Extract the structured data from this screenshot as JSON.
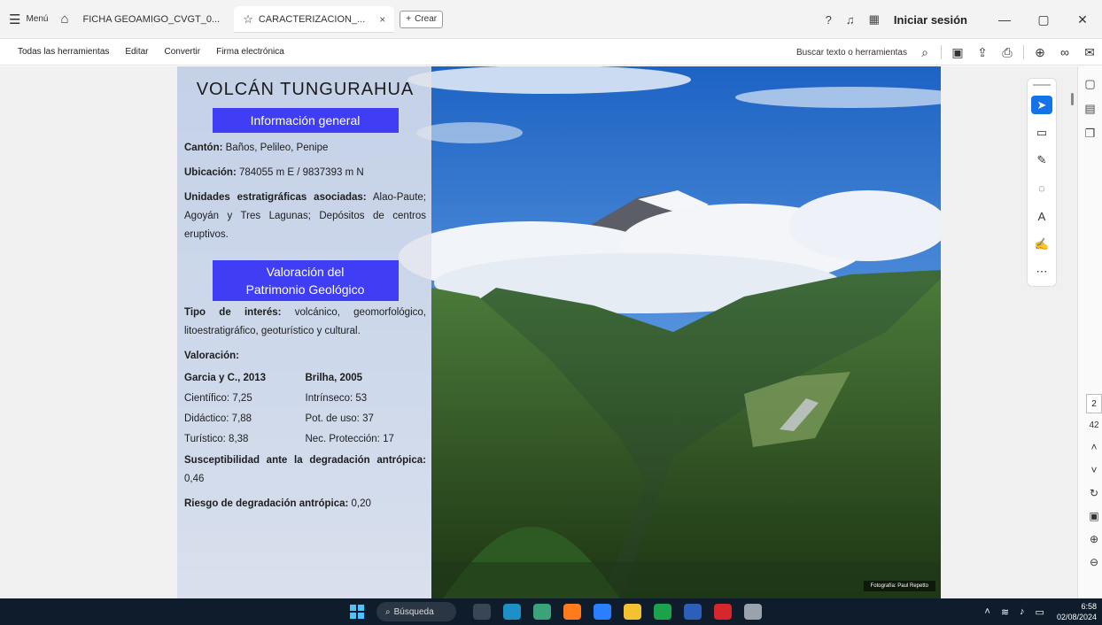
{
  "titlebar": {
    "menu_label": "Menú",
    "tabs": [
      {
        "label": "FICHA GEOAMIGO_CVGT_0...",
        "active": false
      },
      {
        "label": "CARACTERIZACION_...",
        "active": true
      }
    ],
    "create_label": "Crear",
    "signin_label": "Iniciar sesión"
  },
  "toolbar": {
    "items": [
      "Todas las herramientas",
      "Editar",
      "Convertir",
      "Firma electrónica"
    ],
    "search_label": "Buscar texto o herramientas"
  },
  "document": {
    "title": "VOLCÁN TUNGURAHUA",
    "section1": "Información general",
    "canton_label": "Cantón:",
    "canton_value": "Baños, Pelileo, Penipe",
    "ubicacion_label": "Ubicación:",
    "ubicacion_value": "784055 m E / 9837393 m N",
    "unidades_label": "Unidades estratigráficas asociadas:",
    "unidades_value": "Alao-Paute; Agoyán y Tres Lagunas; Depósitos de centros eruptivos.",
    "section2_line1": "Valoración del",
    "section2_line2": "Patrimonio Geológico",
    "tipo_label": "Tipo de interés:",
    "tipo_value": "volcánico, geomorfológico, litoestratigráfico, geoturístico y cultural.",
    "valoracion_label": "Valoración:",
    "col1_header": "Garcia y C., 2013",
    "col2_header": "Brilha, 2005",
    "col1": [
      "Científico: 7,25",
      "Didáctico: 7,88",
      "Turístico: 8,38"
    ],
    "col2": [
      "Intrínseco: 53",
      "Pot. de uso: 37",
      "Nec. Protección: 17"
    ],
    "suscept_label": "Susceptibilidad ante la degradación antrópica:",
    "suscept_value": "0,46",
    "riesgo_label": "Riesgo de degradación antrópica:",
    "riesgo_value": "0,20",
    "photo_credit": "Fotografía: Paul Repetto"
  },
  "pager": {
    "current": "2",
    "total": "42"
  },
  "taskbar": {
    "search_label": "Búsqueda",
    "time": "6:58",
    "date": "02/08/2024",
    "app_colors": [
      "#3a4556",
      "#1e90c8",
      "#3aa37a",
      "#ff7b1c",
      "#2a7fff",
      "#f2c230",
      "#1aa34a",
      "#2b5fb8",
      "#d8262d",
      "#9aa3ad"
    ]
  },
  "colors": {
    "band": "#3f3ef5",
    "select": "#1473e6",
    "taskbar": "#0f1c2c"
  }
}
